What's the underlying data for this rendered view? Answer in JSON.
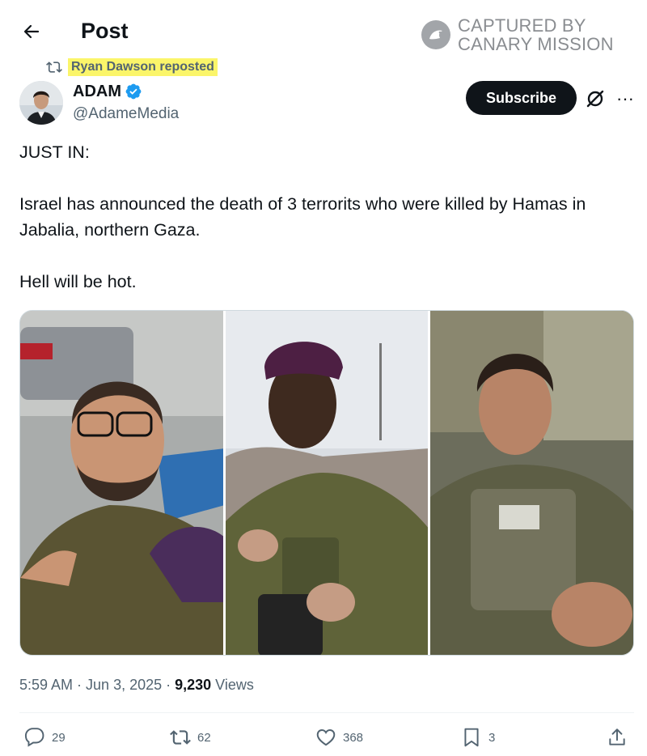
{
  "header": {
    "title": "Post"
  },
  "watermark": {
    "line1": "CAPTURED BY",
    "line2": "CANARY MISSION"
  },
  "repost": {
    "text": "Ryan Dawson reposted"
  },
  "author": {
    "name": "ADAM",
    "handle": "@AdameMedia",
    "verified": true
  },
  "buttons": {
    "subscribe": "Subscribe",
    "more": "···"
  },
  "tweet": {
    "line1": "JUST IN:",
    "line2": "Israel has announced the death of 3 terrorits who were killed by Hamas in Jabalia, northern Gaza.",
    "line3": "Hell will be hot."
  },
  "meta": {
    "time": "5:59 AM",
    "sep1": " · ",
    "date": "Jun 3, 2025",
    "sep2": " · ",
    "views_count": "9,230",
    "views_label": " Views"
  },
  "actions": {
    "replies": "29",
    "reposts": "62",
    "likes": "368",
    "bookmarks": "3"
  },
  "colors": {
    "text": "#0f1419",
    "secondary": "#536471",
    "highlight": "#fbf56a",
    "verified": "#1d9bf0",
    "watermark": "#8a8d91"
  },
  "icons": [
    "back-arrow-icon",
    "canary-logo-icon",
    "repost-icon",
    "verified-badge-icon",
    "grok-icon",
    "more-icon",
    "reply-icon",
    "like-icon",
    "bookmark-icon",
    "share-icon"
  ]
}
